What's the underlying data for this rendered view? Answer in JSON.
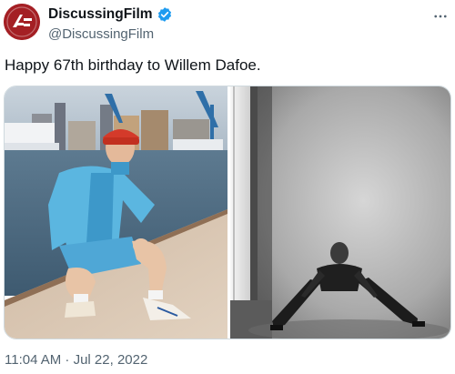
{
  "author": {
    "display_name": "DiscussingFilm",
    "handle": "@DiscussingFilm",
    "verified": true,
    "avatar_icon": "discussingfilm-logo-icon",
    "avatar_color": "#a41f24"
  },
  "tweet": {
    "text": "Happy 67th birthday to Willem Dafoe.",
    "timestamp": "11:04 AM · Jul 22, 2022"
  },
  "media": {
    "photos": [
      {
        "name": "color-portrait-harbor",
        "style": "color"
      },
      {
        "name": "black-and-white-studio-portrait",
        "style": "grayscale"
      }
    ]
  },
  "colors": {
    "verified_badge": "#1d9bf0",
    "text_primary": "#0f1419",
    "text_secondary": "#536471"
  }
}
